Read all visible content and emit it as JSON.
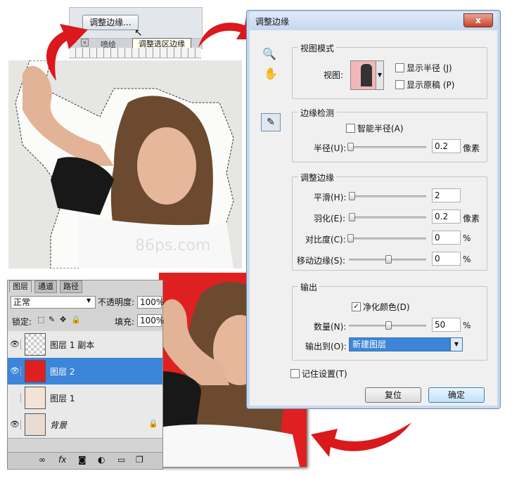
{
  "toolbar": {
    "refine_edge_button": "调整边缘...",
    "tooltip": "调整选区边缘",
    "tab_prefix": "*",
    "tab_name": "喷绘"
  },
  "dialog": {
    "title": "调整边缘",
    "close": "x",
    "view_mode": {
      "group_title": "视图模式",
      "view_label": "视图:",
      "show_radius": "显示半径 (J)",
      "show_original": "显示原稿 (P)"
    },
    "edge_detection": {
      "group_title": "边缘检测",
      "smart_radius": "智能半径(A)",
      "radius_label": "半径(U):",
      "radius_value": "0.2",
      "radius_unit": "像素"
    },
    "adjust_edge": {
      "group_title": "调整边缘",
      "smooth_label": "平滑(H):",
      "smooth_value": "2",
      "feather_label": "羽化(E):",
      "feather_value": "0.2",
      "feather_unit": "像素",
      "contrast_label": "对比度(C):",
      "contrast_value": "0",
      "contrast_unit": "%",
      "shift_label": "移动边缘(S):",
      "shift_value": "0",
      "shift_unit": "%"
    },
    "output": {
      "group_title": "输出",
      "decontaminate": "净化颜色(D)",
      "amount_label": "数量(N):",
      "amount_value": "50",
      "amount_unit": "%",
      "output_to_label": "输出到(O):",
      "output_to_value": "新建图层"
    },
    "remember": "记住设置(T)",
    "reset": "复位",
    "ok": "确定"
  },
  "layers": {
    "tabs": [
      "图层",
      "通道",
      "路径"
    ],
    "blend_mode": "正常",
    "opacity_label": "不透明度:",
    "opacity_value": "100%",
    "lock_label": "锁定:",
    "fill_label": "填充:",
    "fill_value": "100%",
    "items": [
      {
        "name": "图层 1 副本",
        "visible": true,
        "selected": false
      },
      {
        "name": "图层 2",
        "visible": true,
        "selected": true
      },
      {
        "name": "图层 1",
        "visible": false,
        "selected": false
      },
      {
        "name": "背景",
        "visible": true,
        "selected": false
      }
    ]
  },
  "watermark": "86ps.com",
  "colors": {
    "accent_red": "#e02020",
    "selection_blue": "#3d85d8",
    "arrow_red": "#d9191c"
  }
}
